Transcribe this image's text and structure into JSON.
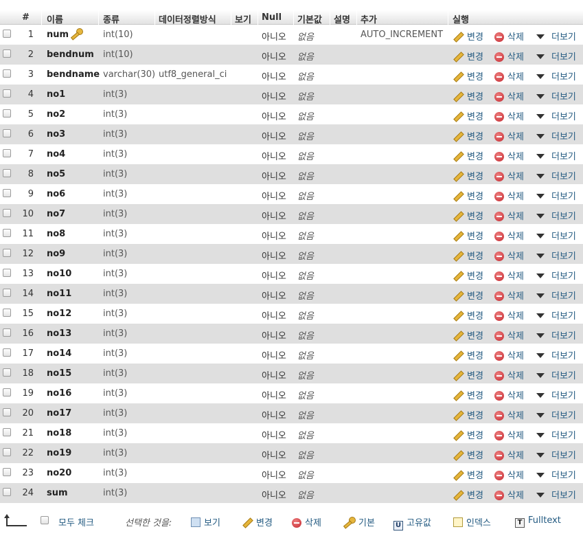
{
  "header": {
    "num": "#",
    "name": "이름",
    "type": "종류",
    "collation": "데이터정렬방식",
    "attributes": "보기",
    "null": "Null",
    "default": "기본값",
    "comment": "설명",
    "extra": "추가",
    "action": "실행"
  },
  "actions": {
    "edit": "변경",
    "delete": "삭제",
    "more": "더보기"
  },
  "rows": [
    {
      "num": "1",
      "name": "num",
      "type": "int(10)",
      "collation": "",
      "null": "아니오",
      "default": "없음",
      "extra": "AUTO_INCREMENT",
      "primary": true
    },
    {
      "num": "2",
      "name": "bendnum",
      "type": "int(10)",
      "collation": "",
      "null": "아니오",
      "default": "없음",
      "extra": ""
    },
    {
      "num": "3",
      "name": "bendname",
      "type": "varchar(30)",
      "collation": "utf8_general_ci",
      "null": "아니오",
      "default": "없음",
      "extra": ""
    },
    {
      "num": "4",
      "name": "no1",
      "type": "int(3)",
      "collation": "",
      "null": "아니오",
      "default": "없음",
      "extra": ""
    },
    {
      "num": "5",
      "name": "no2",
      "type": "int(3)",
      "collation": "",
      "null": "아니오",
      "default": "없음",
      "extra": ""
    },
    {
      "num": "6",
      "name": "no3",
      "type": "int(3)",
      "collation": "",
      "null": "아니오",
      "default": "없음",
      "extra": ""
    },
    {
      "num": "7",
      "name": "no4",
      "type": "int(3)",
      "collation": "",
      "null": "아니오",
      "default": "없음",
      "extra": ""
    },
    {
      "num": "8",
      "name": "no5",
      "type": "int(3)",
      "collation": "",
      "null": "아니오",
      "default": "없음",
      "extra": ""
    },
    {
      "num": "9",
      "name": "no6",
      "type": "int(3)",
      "collation": "",
      "null": "아니오",
      "default": "없음",
      "extra": ""
    },
    {
      "num": "10",
      "name": "no7",
      "type": "int(3)",
      "collation": "",
      "null": "아니오",
      "default": "없음",
      "extra": ""
    },
    {
      "num": "11",
      "name": "no8",
      "type": "int(3)",
      "collation": "",
      "null": "아니오",
      "default": "없음",
      "extra": ""
    },
    {
      "num": "12",
      "name": "no9",
      "type": "int(3)",
      "collation": "",
      "null": "아니오",
      "default": "없음",
      "extra": ""
    },
    {
      "num": "13",
      "name": "no10",
      "type": "int(3)",
      "collation": "",
      "null": "아니오",
      "default": "없음",
      "extra": ""
    },
    {
      "num": "14",
      "name": "no11",
      "type": "int(3)",
      "collation": "",
      "null": "아니오",
      "default": "없음",
      "extra": ""
    },
    {
      "num": "15",
      "name": "no12",
      "type": "int(3)",
      "collation": "",
      "null": "아니오",
      "default": "없음",
      "extra": ""
    },
    {
      "num": "16",
      "name": "no13",
      "type": "int(3)",
      "collation": "",
      "null": "아니오",
      "default": "없음",
      "extra": ""
    },
    {
      "num": "17",
      "name": "no14",
      "type": "int(3)",
      "collation": "",
      "null": "아니오",
      "default": "없음",
      "extra": ""
    },
    {
      "num": "18",
      "name": "no15",
      "type": "int(3)",
      "collation": "",
      "null": "아니오",
      "default": "없음",
      "extra": ""
    },
    {
      "num": "19",
      "name": "no16",
      "type": "int(3)",
      "collation": "",
      "null": "아니오",
      "default": "없음",
      "extra": ""
    },
    {
      "num": "20",
      "name": "no17",
      "type": "int(3)",
      "collation": "",
      "null": "아니오",
      "default": "없음",
      "extra": ""
    },
    {
      "num": "21",
      "name": "no18",
      "type": "int(3)",
      "collation": "",
      "null": "아니오",
      "default": "없음",
      "extra": ""
    },
    {
      "num": "22",
      "name": "no19",
      "type": "int(3)",
      "collation": "",
      "null": "아니오",
      "default": "없음",
      "extra": ""
    },
    {
      "num": "23",
      "name": "no20",
      "type": "int(3)",
      "collation": "",
      "null": "아니오",
      "default": "없음",
      "extra": ""
    },
    {
      "num": "24",
      "name": "sum",
      "type": "int(3)",
      "collation": "",
      "null": "아니오",
      "default": "없음",
      "extra": ""
    }
  ],
  "footer": {
    "check_all": "모두 체크",
    "with_selected": "선택한 것을:",
    "browse": "보기",
    "change": "변경",
    "drop": "삭제",
    "primary": "기본",
    "unique": "고유값",
    "index": "인덱스",
    "fulltext": "Fulltext"
  },
  "colors": {
    "link": "#235a81",
    "row_alt": "#dfdfdf"
  }
}
